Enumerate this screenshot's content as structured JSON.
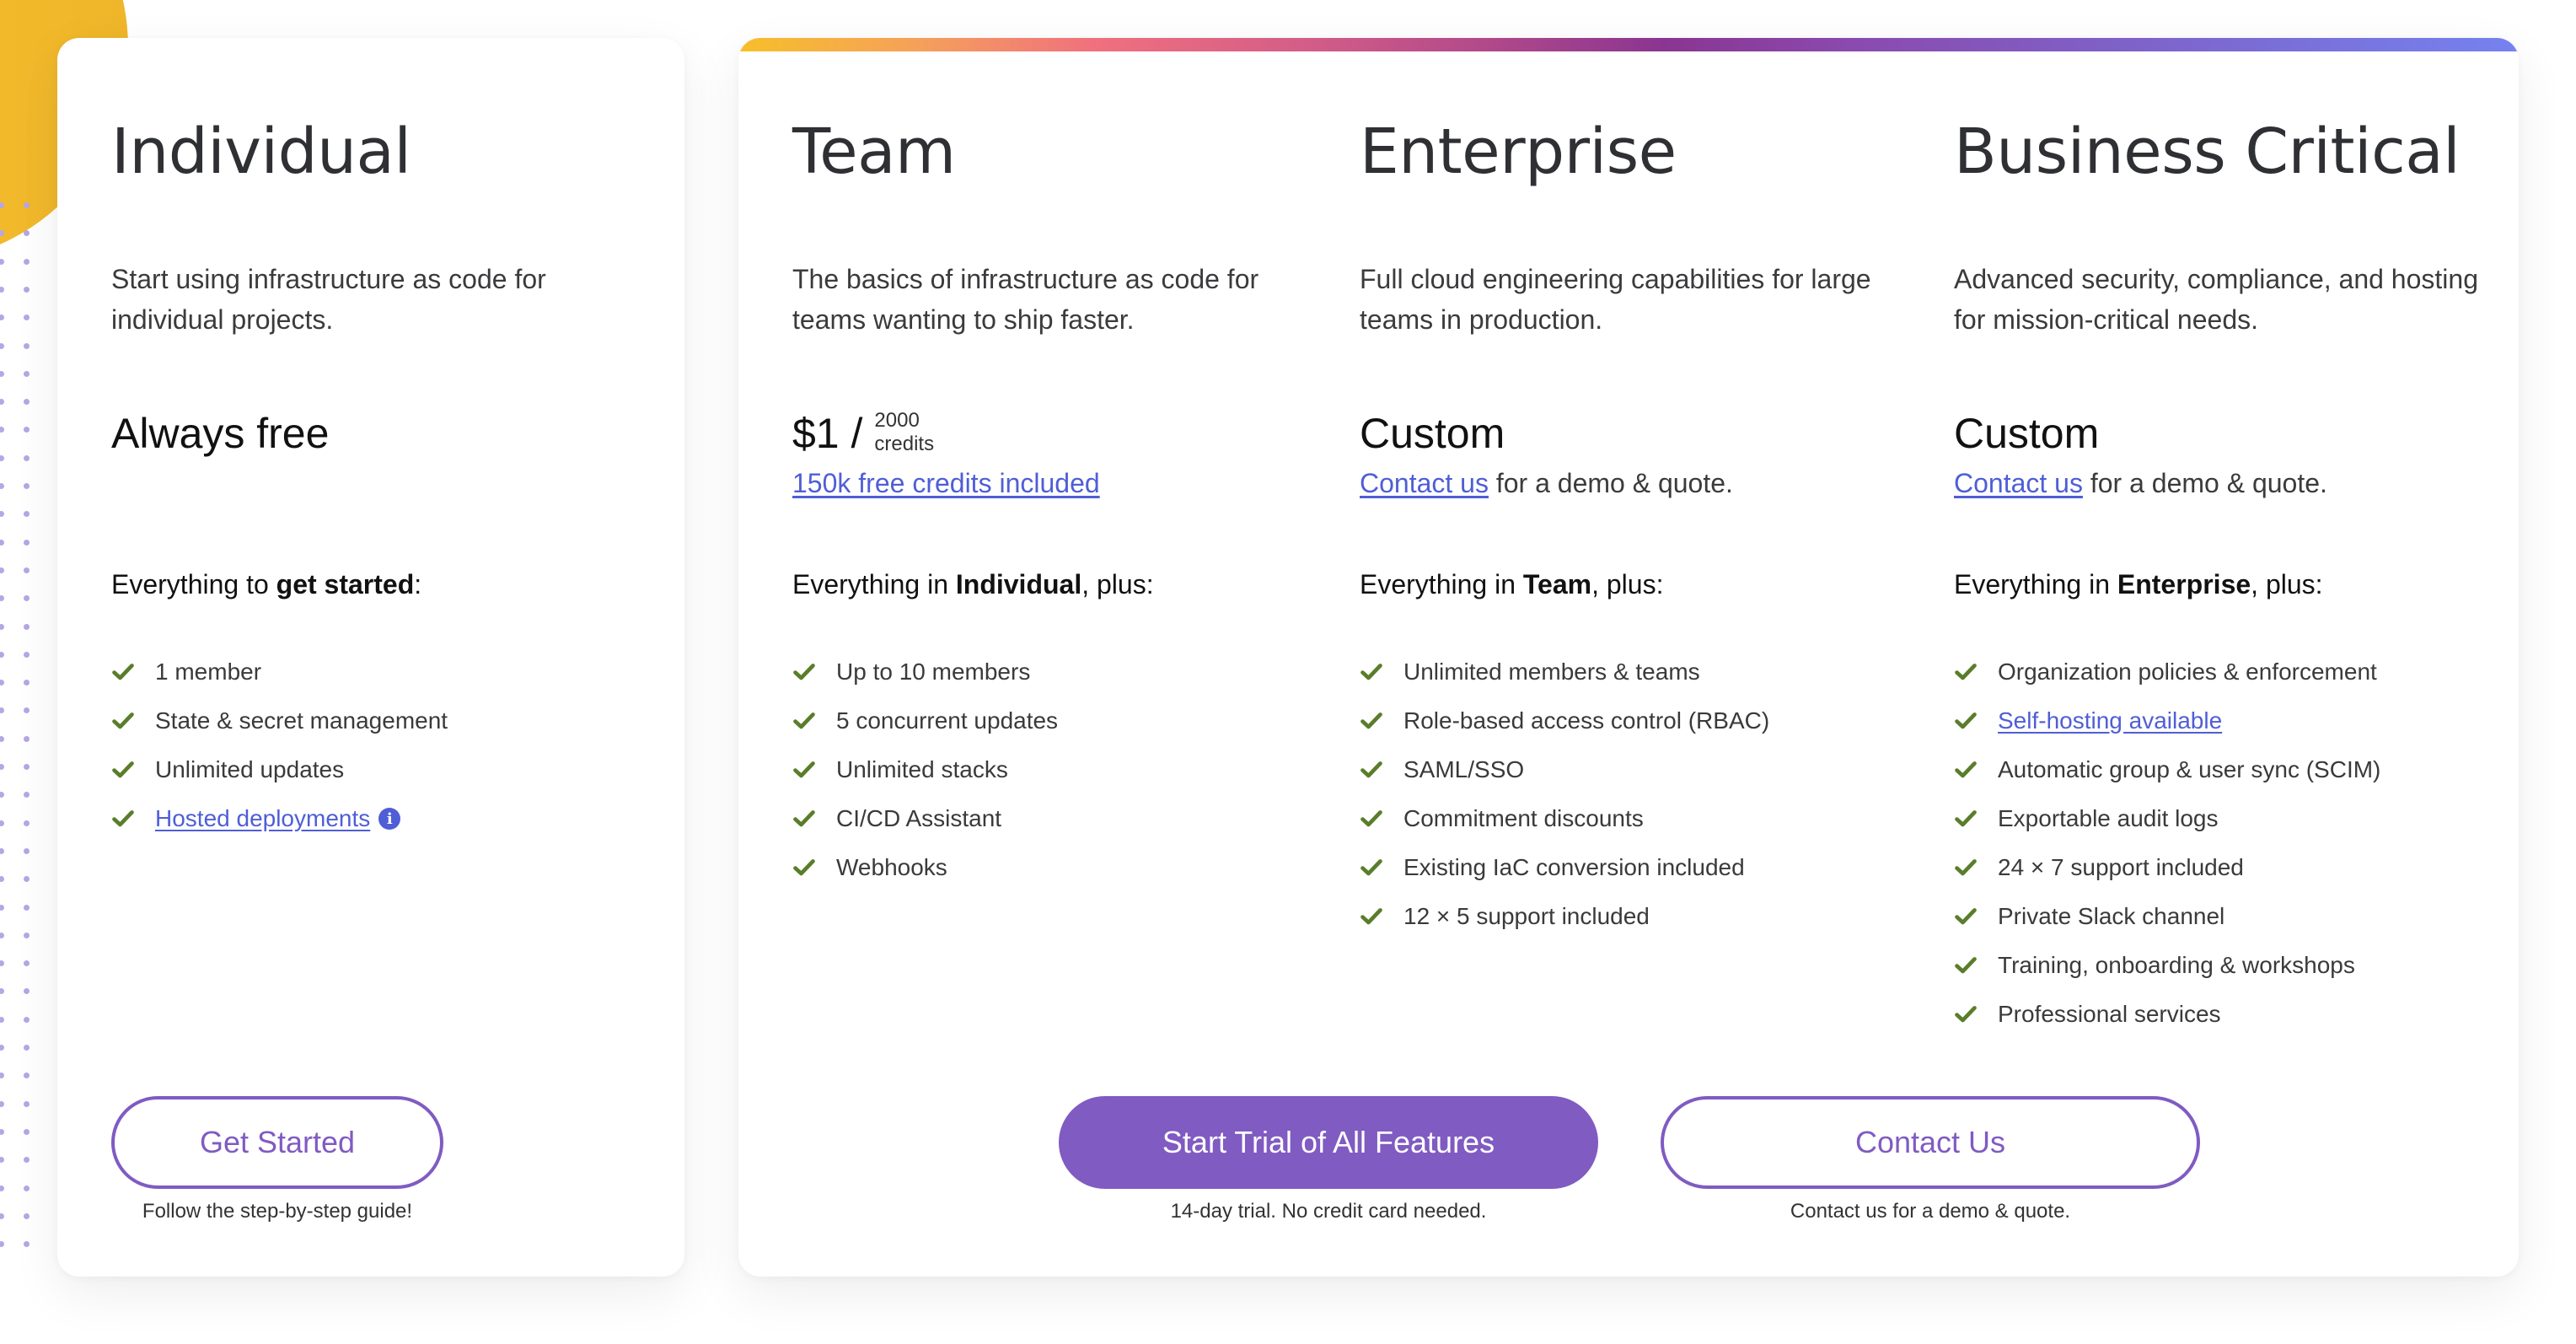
{
  "colors": {
    "accent": "#805bc2",
    "link": "#4f5ed6",
    "check": "#5a7d2a",
    "decor_yellow": "#f8c12c",
    "gradient": [
      "#f7bf2a",
      "#f0707e",
      "#8a3591",
      "#7582f0"
    ]
  },
  "plans": {
    "individual": {
      "title": "Individual",
      "description": "Start using infrastructure as code for individual projects.",
      "price": "Always free",
      "everything_prefix": "Everything to ",
      "everything_bold": "get started",
      "everything_suffix": ":",
      "features": [
        {
          "text": "1 member",
          "icon": "check-icon"
        },
        {
          "text": "State & secret management",
          "icon": "check-icon"
        },
        {
          "text": "Unlimited updates",
          "icon": "check-icon"
        },
        {
          "text": "Hosted deployments",
          "icon": "check-icon",
          "link": true,
          "info_icon": "i"
        }
      ],
      "button": "Get Started",
      "caption": "Follow the step-by-step guide!"
    },
    "team": {
      "title": "Team",
      "description": "The basics of infrastructure as code for teams wanting to ship faster.",
      "price": "$1 /",
      "price_unit_top": "2000",
      "price_unit_bottom": "credits",
      "price_link": "150k free credits included",
      "everything_prefix": "Everything in ",
      "everything_bold": "Individual",
      "everything_suffix": ", plus:",
      "features": [
        {
          "text": "Up to 10 members"
        },
        {
          "text": "5 concurrent updates"
        },
        {
          "text": "Unlimited stacks"
        },
        {
          "text": "CI/CD Assistant"
        },
        {
          "text": "Webhooks"
        }
      ]
    },
    "enterprise": {
      "title": "Enterprise",
      "description": "Full cloud engineering capabilities for large teams in production.",
      "price": "Custom",
      "price_link": "Contact us",
      "price_sub_rest": " for a demo & quote.",
      "everything_prefix": "Everything in ",
      "everything_bold": "Team",
      "everything_suffix": ", plus:",
      "features": [
        {
          "text": "Unlimited members & teams"
        },
        {
          "text": "Role-based access control (RBAC)"
        },
        {
          "text": "SAML/SSO"
        },
        {
          "text": "Commitment discounts"
        },
        {
          "text": "Existing IaC conversion included"
        },
        {
          "text": "12 × 5 support included"
        }
      ]
    },
    "business_critical": {
      "title": "Business Critical",
      "description": "Advanced security, compliance, and hosting for mission-critical needs.",
      "price": "Custom",
      "price_link": "Contact us",
      "price_sub_rest": " for a demo & quote.",
      "everything_prefix": "Everything in ",
      "everything_bold": "Enterprise",
      "everything_suffix": ", plus:",
      "features": [
        {
          "text": "Organization policies & enforcement"
        },
        {
          "text": "Self-hosting available",
          "link": true
        },
        {
          "text": "Automatic group & user sync (SCIM)"
        },
        {
          "text": "Exportable audit logs"
        },
        {
          "text": "24 × 7 support included"
        },
        {
          "text": "Private Slack channel"
        },
        {
          "text": "Training, onboarding & workshops"
        },
        {
          "text": "Professional services"
        }
      ]
    }
  },
  "actions": {
    "trial_button": "Start Trial of All Features",
    "trial_caption": "14-day trial. No credit card needed.",
    "contact_button": "Contact Us",
    "contact_caption": "Contact us for a demo & quote."
  }
}
